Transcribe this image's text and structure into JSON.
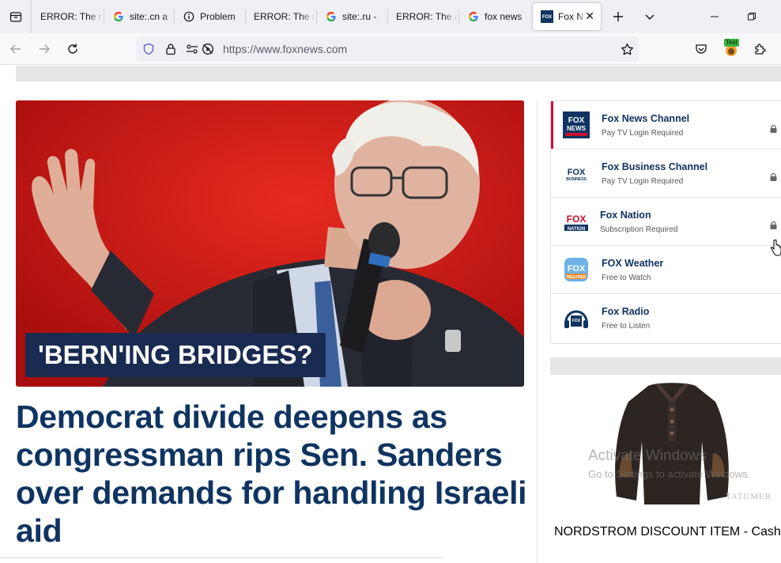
{
  "browser": {
    "tabs": [
      {
        "title": "ERROR: The r",
        "favicon": "error-page-icon"
      },
      {
        "title": "site:.cn a",
        "favicon": "google-g-icon"
      },
      {
        "title": "Problem",
        "favicon": "info-circle-icon"
      },
      {
        "title": "ERROR: The r",
        "favicon": "error-page-icon"
      },
      {
        "title": "site:.ru -",
        "favicon": "google-g-icon"
      },
      {
        "title": "ERROR: The r",
        "favicon": "error-page-icon"
      },
      {
        "title": "fox news",
        "favicon": "google-g-icon"
      },
      {
        "title": "Fox N",
        "favicon": "fox-news-icon",
        "active": true
      }
    ],
    "url": "https://www.foxnews.com",
    "extension_badge": "Test"
  },
  "hero": {
    "kicker": "'BERN'ING BRIDGES?",
    "headline": "Democrat divide deepens as congressman rips Sen. Sanders over demands for handling Israeli aid"
  },
  "watch": {
    "items": [
      {
        "title": "Fox News Channel",
        "subtitle": "Pay TV Login Required",
        "logo": "fox-news-channel-logo",
        "locked": true
      },
      {
        "title": "Fox Business Channel",
        "subtitle": "Pay TV Login Required",
        "logo": "fox-business-logo",
        "locked": true
      },
      {
        "title": "Fox Nation",
        "subtitle": "Subscription Required",
        "logo": "fox-nation-logo",
        "locked": true
      },
      {
        "title": "FOX Weather",
        "subtitle": "Free to Watch",
        "logo": "fox-weather-logo",
        "locked": false
      },
      {
        "title": "Fox Radio",
        "subtitle": "Free to Listen",
        "logo": "fox-radio-logo",
        "locked": false
      }
    ]
  },
  "ad": {
    "brand_watermark": "TATUMER",
    "title": "NORDSTROM DISCOUNT ITEM - Cashmere Casual Stand Collar Lon..."
  },
  "os_watermark": {
    "line1": "Activate Windows",
    "line2": "Go to Settings to activate Windows."
  },
  "colors": {
    "headline": "#0f3461",
    "hero_bg": "#cc1a1a",
    "kicker_bg": "#1a2b52",
    "active_accent": "#c8102e"
  }
}
